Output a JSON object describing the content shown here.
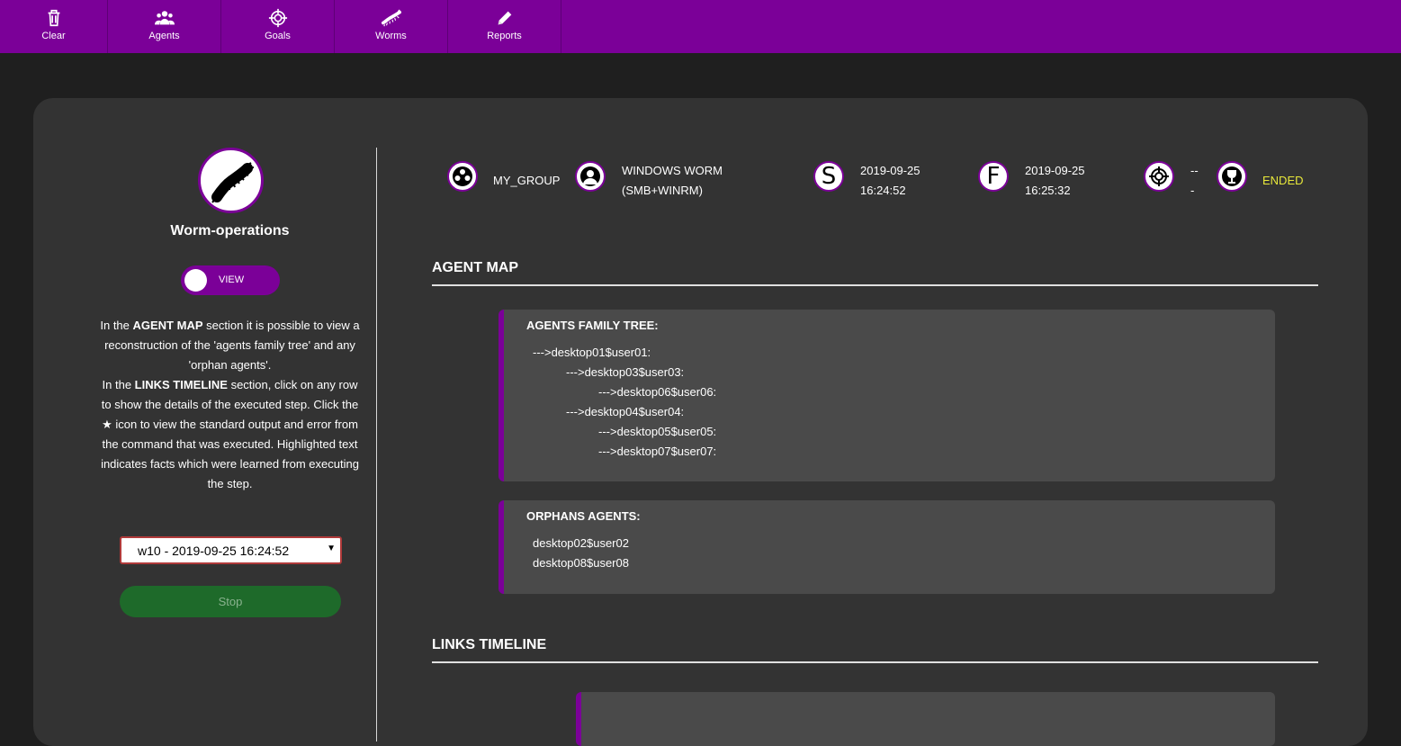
{
  "nav": [
    {
      "label": "Clear",
      "icon": "trash-icon"
    },
    {
      "label": "Agents",
      "icon": "users-icon"
    },
    {
      "label": "Goals",
      "icon": "crosshair-icon"
    },
    {
      "label": "Worms",
      "icon": "worm-icon"
    },
    {
      "label": "Reports",
      "icon": "pencil-icon"
    }
  ],
  "sidebar": {
    "plugin_name": "Worm-operations",
    "toggle_label": "VIEW",
    "description": [
      {
        "pre": "In the ",
        "bold": "AGENT MAP",
        "post": " section it is possible to view a reconstruction of the 'agents family tree' and any 'orphan agents'."
      },
      {
        "pre": "In the ",
        "bold": "LINKS TIMELINE",
        "post": " section, click on any row to show the details of the executed step. Click the ★ icon to view the standard output and error from the command that was executed. Highlighted text indicates facts which were learned from executing the step."
      }
    ],
    "operation_select": "w10 - 2019-09-25 16:24:52",
    "stop_label": "Stop"
  },
  "header": {
    "group": "MY_GROUP",
    "adversary_line1": "WINDOWS WORM",
    "adversary_line2": "(SMB+WINRM)",
    "start_date": "2019-09-25",
    "start_time": "16:24:52",
    "finish_date": "2019-09-25",
    "finish_time": "16:25:32",
    "goal_line1": "--",
    "goal_line2": "-",
    "state": "ENDED",
    "start_letter": "S",
    "finish_letter": "F"
  },
  "agent_map": {
    "title": "AGENT MAP",
    "family_tree_title": "AGENTS FAMILY TREE:",
    "family_tree": [
      {
        "text": "--->desktop01$user01:",
        "depth": 0
      },
      {
        "text": "--->desktop03$user03:",
        "depth": 1
      },
      {
        "text": "--->desktop06$user06:",
        "depth": 2
      },
      {
        "text": "--->desktop04$user04:",
        "depth": 1
      },
      {
        "text": "--->desktop05$user05:",
        "depth": 2
      },
      {
        "text": "--->desktop07$user07:",
        "depth": 2
      }
    ],
    "orphans_title": "ORPHANS AGENTS:",
    "orphans": [
      "desktop02$user02",
      "desktop08$user08"
    ]
  },
  "links_timeline": {
    "title": "LINKS TIMELINE"
  },
  "colors": {
    "brand": "#7b0098",
    "panel": "#333333",
    "card": "#4a4a4a",
    "ended": "#e8e83a",
    "stop": "#1e6a2a"
  }
}
